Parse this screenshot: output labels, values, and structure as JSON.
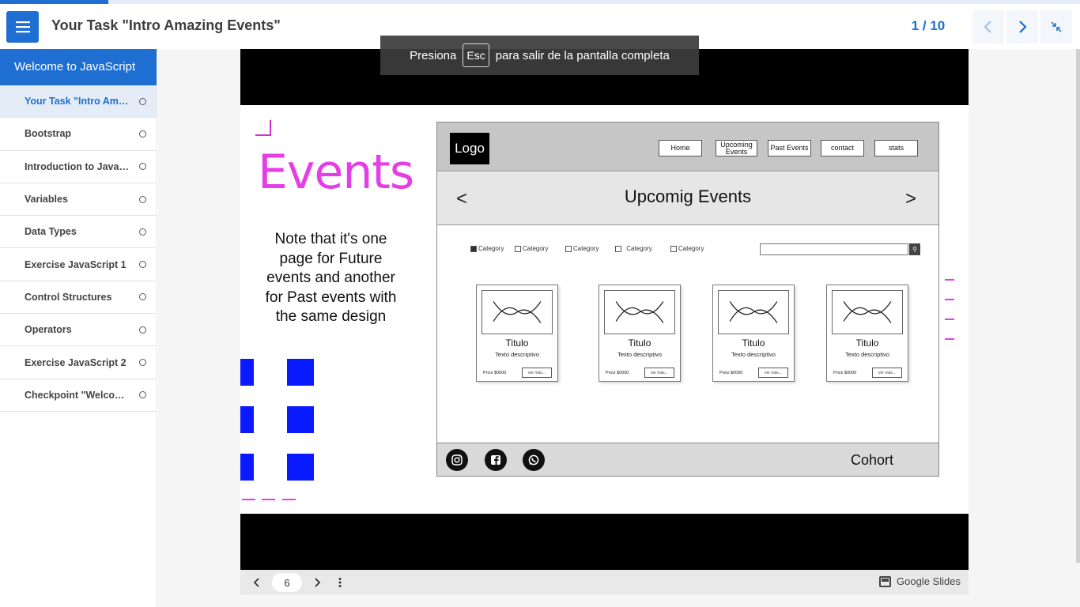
{
  "header": {
    "title": "Your Task \"Intro Amazing Events\"",
    "page_indicator": "1 / 10",
    "progress_fraction": 0.1
  },
  "fullscreen_toast": {
    "before": "Presiona",
    "key": "Esc",
    "after": "para salir de la pantalla completa"
  },
  "sidebar": {
    "header": "Welcome to JavaScript",
    "items": [
      {
        "label": "Your Task \"Intro Amazing Events\"",
        "active": true
      },
      {
        "label": "Bootstrap"
      },
      {
        "label": "Introduction to JavaScript"
      },
      {
        "label": "Variables"
      },
      {
        "label": "Data Types"
      },
      {
        "label": "Exercise JavaScript 1"
      },
      {
        "label": "Control Structures"
      },
      {
        "label": "Operators"
      },
      {
        "label": "Exercise JavaScript 2"
      },
      {
        "label": "Checkpoint \"Welcome to JavaScript\""
      }
    ]
  },
  "slide": {
    "heading": "Events",
    "note": "Note that it's one page for Future events and another for Past events with the same design",
    "mockup": {
      "logo": "Logo",
      "nav_links": [
        "Home",
        "Upcoming Events",
        "Past Events",
        "contact",
        "stats"
      ],
      "hero_title": "Upcomig Events",
      "prev_arrow": "<",
      "next_arrow": ">",
      "categories": [
        "Category",
        "Category",
        "Category",
        "Category",
        "Category"
      ],
      "cards": [
        {
          "title": "Titulo",
          "desc": "Texto descriptivo",
          "price": "Price $0000",
          "more": "ver más..."
        },
        {
          "title": "Titulo",
          "desc": "Texto descriptivo",
          "price": "Price $0000",
          "more": "ver más..."
        },
        {
          "title": "Titulo",
          "desc": "Texto descriptivo",
          "price": "Price $0000",
          "more": "ver más..."
        },
        {
          "title": "Titulo",
          "desc": "Texto descriptivo",
          "price": "Price $0000",
          "more": "ver más..."
        }
      ],
      "footer_label": "Cohort",
      "social_icons": [
        "instagram-icon",
        "facebook-icon",
        "whatsapp-icon"
      ]
    }
  },
  "slides_bar": {
    "current_slide": "6",
    "brand": "Google Slides"
  },
  "colors": {
    "accent": "#1e6fd1",
    "events_pink": "#e63ee6",
    "square_blue": "#0a1aff"
  }
}
